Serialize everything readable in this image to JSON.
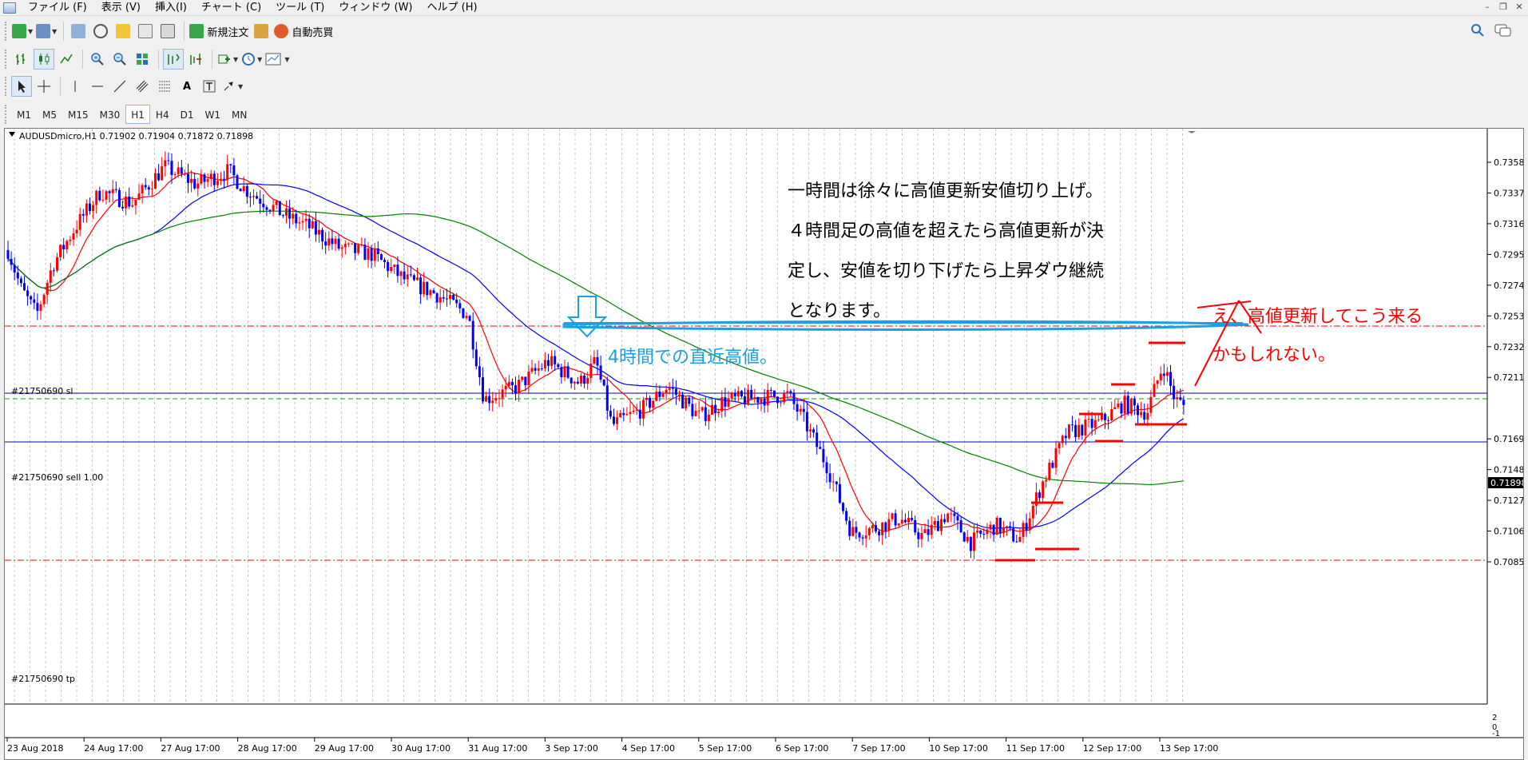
{
  "menu": {
    "items": [
      "ファイル (F)",
      "表示 (V)",
      "挿入(I)",
      "チャート (C)",
      "ツール (T)",
      "ウィンドウ (W)",
      "ヘルプ (H)"
    ]
  },
  "toolbar": {
    "new_order_label": "新規注文",
    "auto_trade_label": "自動売買"
  },
  "timeframes": [
    "M1",
    "M5",
    "M15",
    "M30",
    "H1",
    "H4",
    "D1",
    "W1",
    "MN"
  ],
  "active_timeframe": "H1",
  "chart": {
    "header": "AUDUSDmicro,H1  0.71902  0.71904  0.71872  0.71898",
    "current_price": "0.71898",
    "price_ticks": [
      "0.73580",
      "0.73370",
      "0.73160",
      "0.72950",
      "0.72740",
      "0.72530",
      "0.72320",
      "0.72110",
      "0.71898",
      "0.71690",
      "0.71480",
      "0.71270",
      "0.71060",
      "0.70850"
    ],
    "date_ticks": [
      "23 Aug 2018",
      "24 Aug 17:00",
      "27 Aug 17:00",
      "28 Aug 17:00",
      "29 Aug 17:00",
      "30 Aug 17:00",
      "31 Aug 17:00",
      "3 Sep 17:00",
      "4 Sep 17:00",
      "5 Sep 17:00",
      "6 Sep 17:00",
      "7 Sep 17:00",
      "10 Sep 17:00",
      "11 Sep 17:00",
      "12 Sep 17:00",
      "13 Sep 17:00"
    ],
    "order_labels": {
      "sl": "#21750690 sl",
      "sell": "#21750690 sell 1.00",
      "tp": "#21750690 tp"
    },
    "indicator_scale": [
      "2",
      "0",
      "-1"
    ],
    "colors": {
      "bull_candle": "#ff0000",
      "bear_candle": "#0000ff",
      "ma_fast": "#ff0000",
      "ma_mid": "#0000ff",
      "ma_slow": "#008000",
      "annotation_blue": "#1ba0e0",
      "annotation_red": "#ff0000"
    }
  },
  "annotations": {
    "note_lines": [
      "一時間は徐々に高値更新安値切り上げ。",
      "４時間足の高値を超えたら高値更新が決",
      "定し、安値を切り下げたら上昇ダウ継続",
      "となります。"
    ],
    "blue_label": "4時間での直近高値。",
    "red_lines": [
      "え、高値更新してこう来る",
      "かもしれない。"
    ]
  }
}
